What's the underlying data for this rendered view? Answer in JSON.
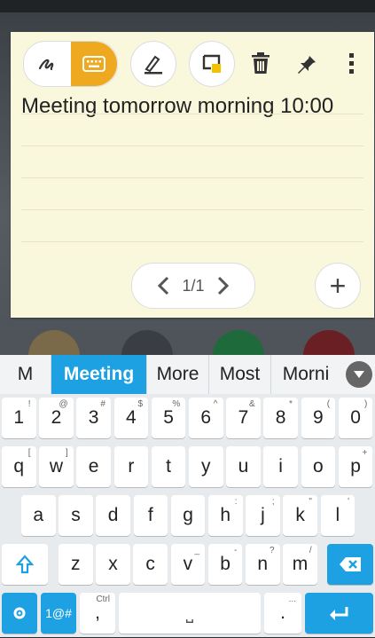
{
  "memo": {
    "note_text": "Meeting tomorrow morning 10:00",
    "pager": {
      "label": "1/1"
    },
    "add_label": "+"
  },
  "suggestions": {
    "items": [
      "M",
      "Meeting",
      "More",
      "Most",
      "Morni"
    ],
    "active_index": 1
  },
  "keyboard": {
    "rows": [
      [
        {
          "k": "1",
          "h": "!"
        },
        {
          "k": "2",
          "h": "@"
        },
        {
          "k": "3",
          "h": "#"
        },
        {
          "k": "4",
          "h": "$"
        },
        {
          "k": "5",
          "h": "%"
        },
        {
          "k": "6",
          "h": "^"
        },
        {
          "k": "7",
          "h": "&"
        },
        {
          "k": "8",
          "h": "*"
        },
        {
          "k": "9",
          "h": "("
        },
        {
          "k": "0",
          "h": ")"
        }
      ],
      [
        {
          "k": "q",
          "h": "["
        },
        {
          "k": "w",
          "h": "]"
        },
        {
          "k": "e",
          "h": ""
        },
        {
          "k": "r",
          "h": ""
        },
        {
          "k": "t",
          "h": ""
        },
        {
          "k": "y",
          "h": ""
        },
        {
          "k": "u",
          "h": ""
        },
        {
          "k": "i",
          "h": ""
        },
        {
          "k": "o",
          "h": ""
        },
        {
          "k": "p",
          "h": "+"
        }
      ],
      [
        {
          "k": "a",
          "h": ""
        },
        {
          "k": "s",
          "h": ""
        },
        {
          "k": "d",
          "h": ""
        },
        {
          "k": "f",
          "h": ""
        },
        {
          "k": "g",
          "h": ""
        },
        {
          "k": "h",
          "h": ":"
        },
        {
          "k": "j",
          "h": ";"
        },
        {
          "k": "k",
          "h": "\""
        },
        {
          "k": "l",
          "h": "'"
        }
      ],
      [
        {
          "k": "z",
          "h": ""
        },
        {
          "k": "x",
          "h": ""
        },
        {
          "k": "c",
          "h": ""
        },
        {
          "k": "v",
          "h": "_"
        },
        {
          "k": "b",
          "h": "-"
        },
        {
          "k": "n",
          "h": "?"
        },
        {
          "k": "m",
          "h": "/"
        }
      ]
    ],
    "symbols_label": "1@#",
    "comma_label": ",",
    "comma_hint": "Ctrl",
    "period_label": ".",
    "period_hint": "...",
    "space_label": "⎵"
  },
  "colors": {
    "accent": "#1ea1e3",
    "memo_bg": "#f9f7dc",
    "tool_active": "#eea920"
  }
}
